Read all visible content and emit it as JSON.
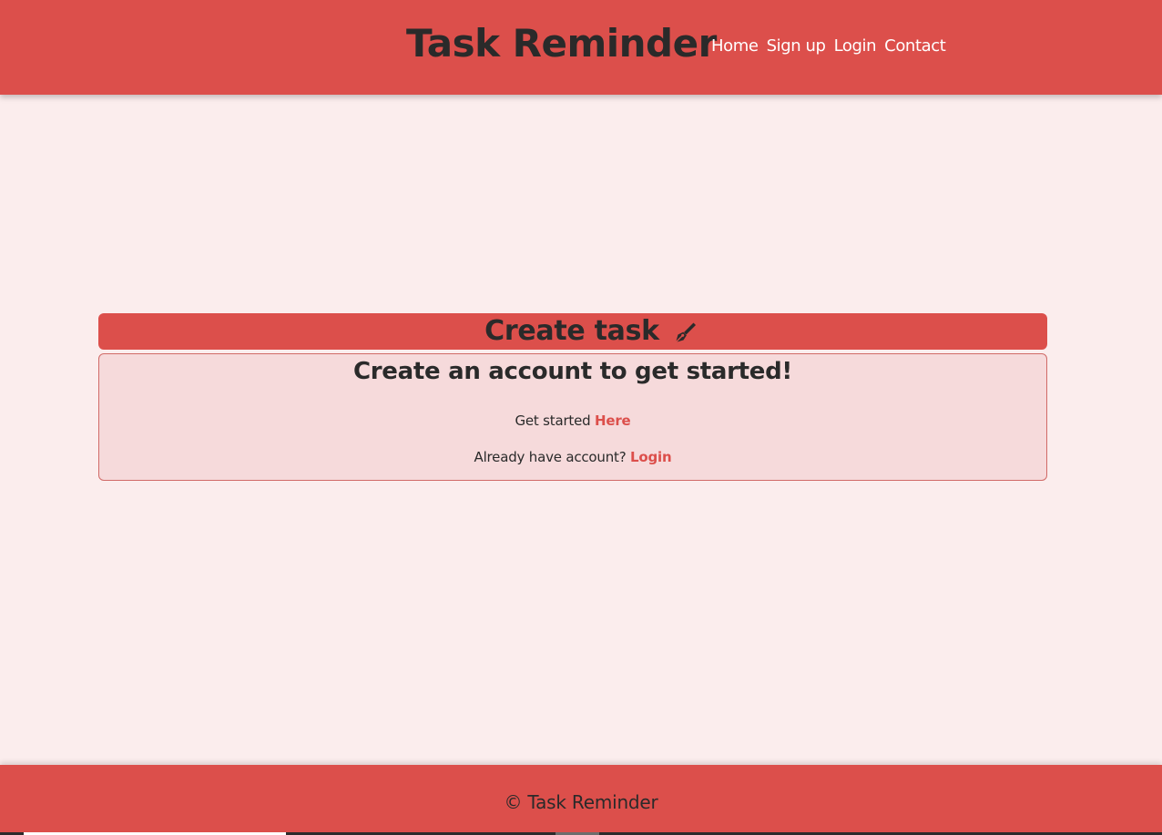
{
  "header": {
    "brand": "Task Reminder",
    "nav": [
      "Home",
      "Sign up",
      "Login",
      "Contact"
    ]
  },
  "main": {
    "task_bar_title": "Create task",
    "task_bar_icon": "pen-icon",
    "account_box": {
      "heading": "Create an account to get started!",
      "get_started_text": "Get started",
      "get_started_link": "Here",
      "existing_text": "Already have account?",
      "existing_link": "Login"
    }
  },
  "footer": {
    "text": "© Task Reminder"
  },
  "colors": {
    "primary": "#dc4f4b",
    "page_background": "#fbeded",
    "box_background": "#f6dadb",
    "nav_text": "#ffffff",
    "dark_text": "#2a2a2a"
  }
}
